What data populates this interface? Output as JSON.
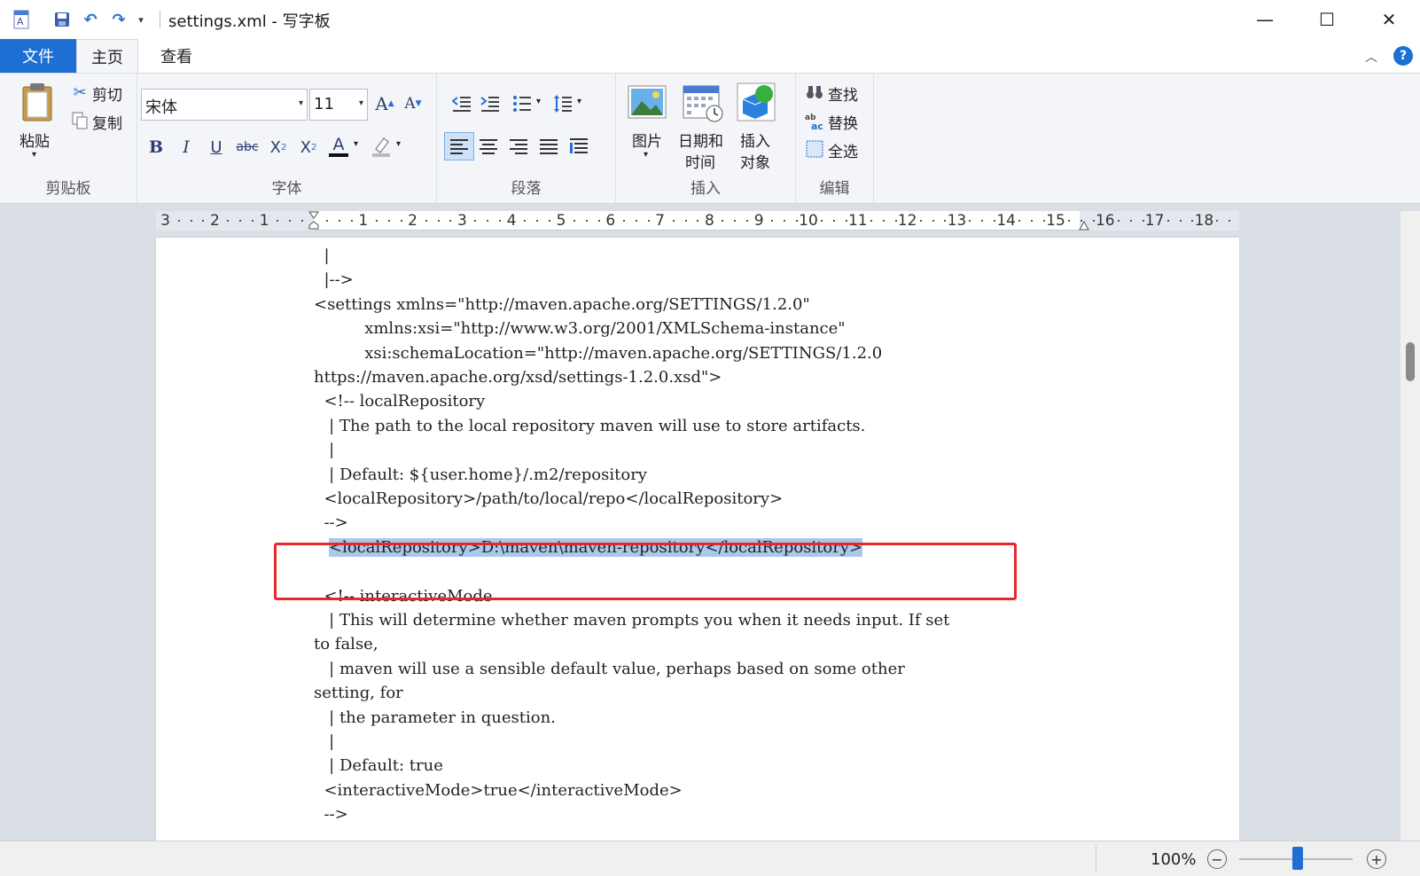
{
  "window": {
    "title": "settings.xml - 写字板",
    "qa_more": "▾",
    "min": "—",
    "max": "☐",
    "close": "✕"
  },
  "tabs": {
    "file": "文件",
    "home": "主页",
    "view": "查看",
    "collapse": "︿",
    "help": "?"
  },
  "ribbon": {
    "clipboard": {
      "label": "剪贴板",
      "paste": "粘贴",
      "cut": "剪切",
      "copy": "复制"
    },
    "font": {
      "label": "字体",
      "family": "宋体",
      "size": "11"
    },
    "paragraph": {
      "label": "段落"
    },
    "insert": {
      "label": "插入",
      "picture": "图片",
      "datetime_1": "日期和",
      "datetime_2": "时间",
      "object_1": "插入",
      "object_2": "对象"
    },
    "editing": {
      "label": "编辑",
      "find": "查找",
      "replace": "替换",
      "select_all": "全选"
    }
  },
  "ruler": {
    "numbers": [
      "3",
      "2",
      "1",
      "1",
      "2",
      "3",
      "4",
      "5",
      "6",
      "7",
      "8",
      "9",
      "10",
      "11",
      "12",
      "13",
      "14",
      "15",
      "16",
      "17",
      "18"
    ]
  },
  "document": {
    "lines": [
      "  |",
      "  |-->",
      "<settings xmlns=\"http://maven.apache.org/SETTINGS/1.2.0\"",
      "          xmlns:xsi=\"http://www.w3.org/2001/XMLSchema-instance\"",
      "          xsi:schemaLocation=\"http://maven.apache.org/SETTINGS/1.2.0",
      "https://maven.apache.org/xsd/settings-1.2.0.xsd\">",
      "  <!-- localRepository",
      "   | The path to the local repository maven will use to store artifacts.",
      "   |",
      "   | Default: ${user.home}/.m2/repository",
      "  <localRepository>/path/to/local/repo</localRepository>",
      "  -->",
      "<localRepository>D:\\maven\\maven-repository</localRepository>",
      "",
      "  <!-- interactiveMode",
      "   | This will determine whether maven prompts you when it needs input. If set",
      "to false,",
      "   | maven will use a sensible default value, perhaps based on some other",
      "setting, for",
      "   | the parameter in question.",
      "   |",
      "   | Default: true",
      "  <interactiveMode>true</interactiveMode>",
      "  -->"
    ]
  },
  "status": {
    "zoom": "100%",
    "zoom_out": "−",
    "zoom_in": "+"
  }
}
